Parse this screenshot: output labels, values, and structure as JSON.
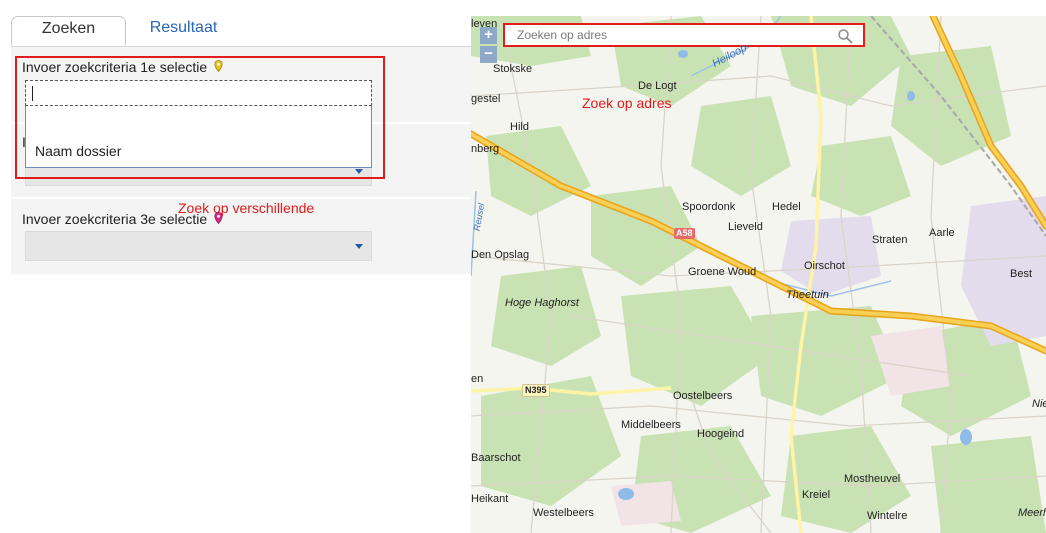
{
  "tabs": [
    {
      "label": "Zoeken",
      "active": true
    },
    {
      "label": "Resultaat",
      "active": false
    }
  ],
  "criteria": {
    "first_label": "Invoer zoekcriteria 1e selectie",
    "first_input_value": "",
    "first_option": "Naam dossier",
    "second_label_fragment": "I",
    "third_label": "Invoer zoekcriteria 3e selectie"
  },
  "annotations": {
    "left": "Zoek op verschillende",
    "map": "Zoek op adres"
  },
  "map": {
    "search_placeholder": "Zoeken op adres",
    "zoom_in": "+",
    "zoom_out": "−",
    "places": {
      "leven": "leven",
      "stokske": "Stokske",
      "de_logt": "De Logt",
      "gestel": "gestel",
      "hild": "Hild",
      "nberg": "nberg",
      "spoordonk": "Spoordonk",
      "hedel": "Hedel",
      "lieveld": "Lieveld",
      "straten": "Straten",
      "aarle": "Aarle",
      "den_opslag": "Den Opslag",
      "oirschot": "Oirschot",
      "groene_woud": "Groene Woud",
      "best": "Best",
      "theetuin": "Theetuin",
      "hoge_haghorst": "Hoge Haghorst",
      "en": "en",
      "oostelbeers": "Oostelbeers",
      "nie": "Nie",
      "middelbeers": "Middelbeers",
      "hoogeind": "Hoogeind",
      "baarschot": "Baarschot",
      "mostheuvel": "Mostheuvel",
      "heikant": "Heikant",
      "kreiel": "Kreiel",
      "westelbeers": "Westelbeers",
      "wintelre": "Wintelre",
      "meerh": "Meerh",
      "heiloop": "Heiloop",
      "reusel": "Reusel"
    },
    "roads": {
      "a58": "A58",
      "n395": "N395"
    }
  },
  "colors": {
    "annotation_red": "#e21b1b",
    "link_blue": "#2a65b5",
    "pin_yellow": "#e8c21a",
    "pin_magenta": "#d9278b",
    "motorway": "#f6b822",
    "forest": "#c9e2b3"
  },
  "icons": {
    "first_pin": "map-pin-yellow",
    "third_pin": "map-pin-magenta",
    "search": "magnifier",
    "caret": "triangle-down"
  }
}
